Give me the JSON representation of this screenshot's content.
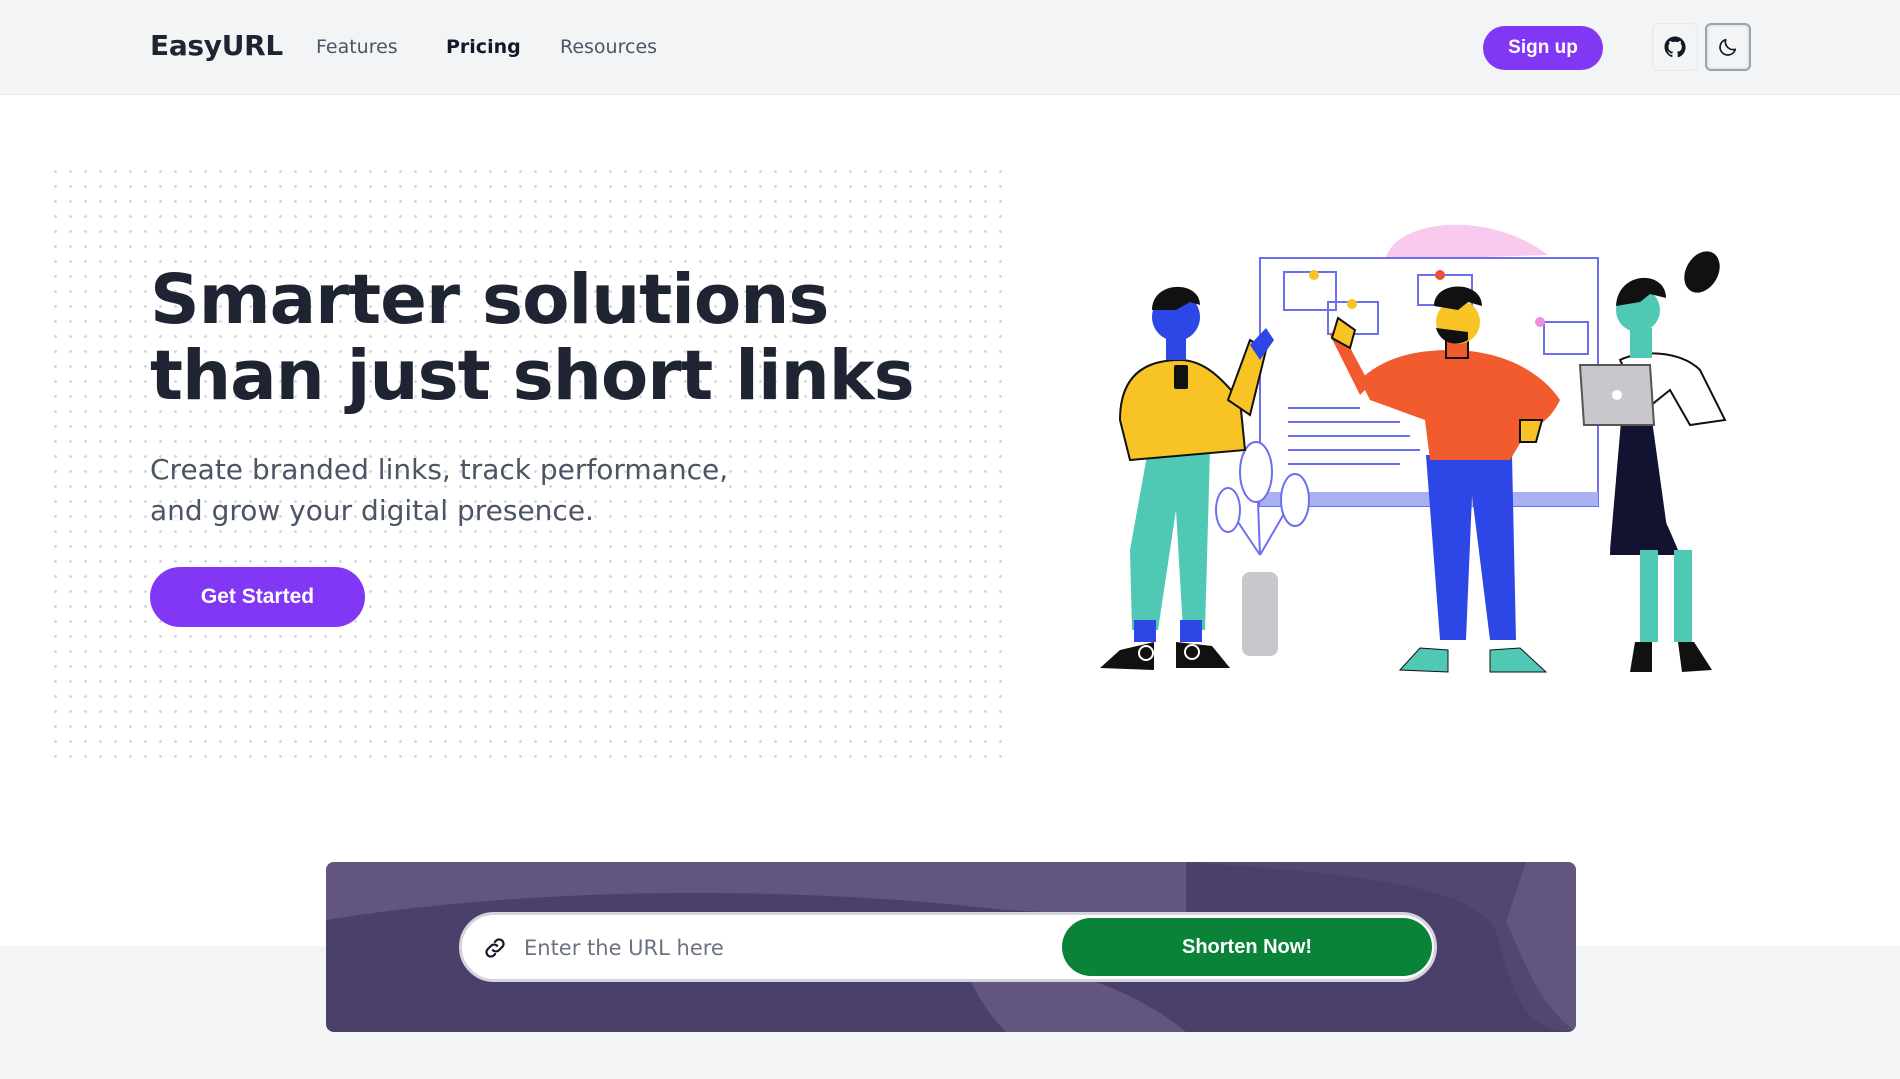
{
  "header": {
    "logo": "EasyURL",
    "nav": [
      "Features",
      "Pricing",
      "Resources"
    ],
    "signup_label": "Sign up",
    "github_icon": "github-icon",
    "theme_icon": "moon-icon"
  },
  "hero": {
    "title_line1": "Smarter solutions",
    "title_line2": "than just short links",
    "subtitle_line1": "Create branded links, track performance,",
    "subtitle_line2": "and grow your digital presence.",
    "cta_label": "Get Started"
  },
  "shortener": {
    "placeholder": "Enter the URL here",
    "button_label": "Shorten Now!",
    "icon": "link-icon"
  },
  "colors": {
    "accent": "#8137f4",
    "cta_green": "#0a8237",
    "panel": "#4b3f6b"
  }
}
